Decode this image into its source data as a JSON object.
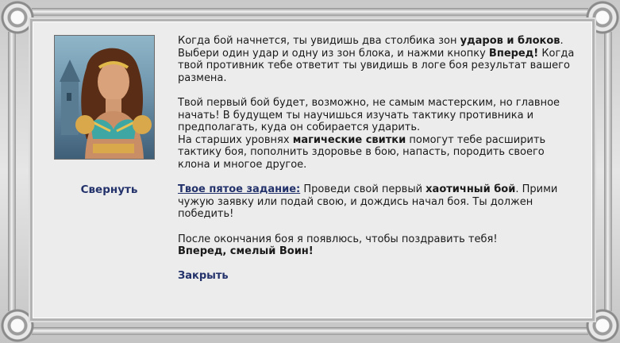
{
  "portrait": {
    "icon": "heroine-portrait"
  },
  "collapse_label": "Свернуть",
  "intro": {
    "p1_a": "Когда бой начнется, ты увидишь два столбика зон ",
    "p1_b": "ударов и блоков",
    "p1_c": ". Выбери один удар и одну из зон блока, и нажми кнопку ",
    "p1_d": "Вперед!",
    "p1_e": " Когда твой противник тебе ответит ты увидишь в логе боя результат вашего размена."
  },
  "advice": {
    "p2_a": "Твой первый бой будет, возможно, не самым мастерским, но главное начать! В будущем ты научишься изучать тактику противника и предполагать, куда он собирается ударить.",
    "p2_b": "На старших уровнях ",
    "p2_c": "магические свитки",
    "p2_d": " помогут тебе расширить тактику боя, пополнить здоровье в бою, напасть, породить своего клона и многое другое."
  },
  "task": {
    "link": "Твое пятое задание:",
    "t_a": " Проведи свой первый ",
    "t_b": "хаотичный бой",
    "t_c": ". Прими чужую заявку или подай свою, и дождись начал боя. Ты должен победить!"
  },
  "outro": {
    "line1": "После окончания боя я появлюсь, чтобы поздравить тебя!",
    "line2": "Вперед, смелый Воин!"
  },
  "close_label": "Закрыть",
  "colors": {
    "link": "#23326b",
    "panel": "#ececec",
    "frame": "#c9c9c9"
  }
}
